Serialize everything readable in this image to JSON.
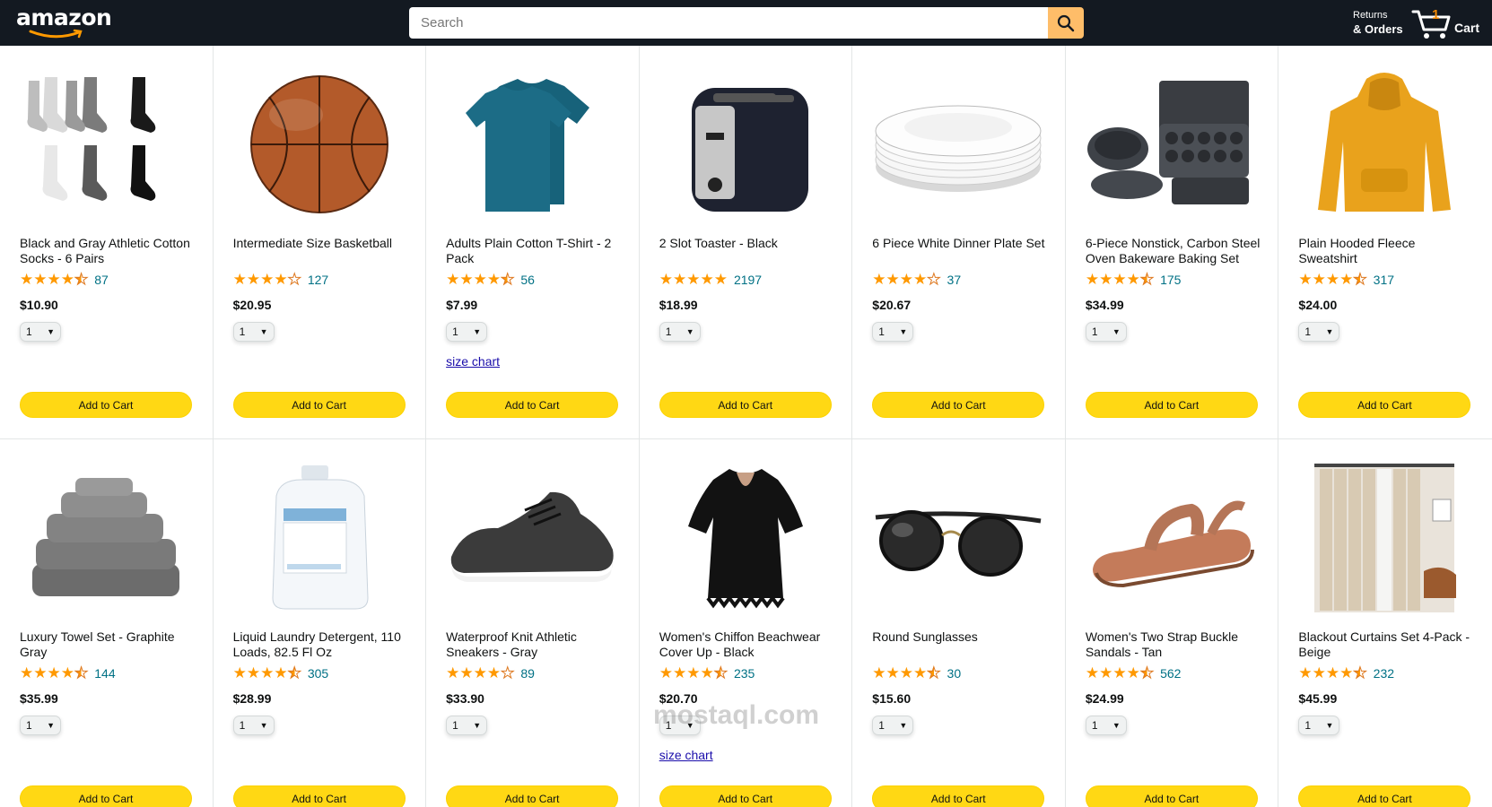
{
  "header": {
    "logo_text": "amazon",
    "search_placeholder": "Search",
    "returns_line1": "Returns",
    "returns_line2": "& Orders",
    "cart_count": "1",
    "cart_label": "Cart"
  },
  "products": [
    {
      "name": "Black and Gray Athletic Cotton Socks - 6 Pairs",
      "stars": 4.5,
      "count": "87",
      "price": "$10.90",
      "qty": "1",
      "button": "Add to Cart",
      "icon": "socks-image"
    },
    {
      "name": "Intermediate Size Basketball",
      "stars": 4,
      "count": "127",
      "price": "$20.95",
      "qty": "1",
      "button": "Add to Cart",
      "icon": "basketball-image"
    },
    {
      "name": "Adults Plain Cotton T-Shirt - 2 Pack",
      "stars": 4.5,
      "count": "56",
      "price": "$7.99",
      "qty": "1",
      "button": "Add to Cart",
      "size_chart": "size chart",
      "icon": "tshirt-image"
    },
    {
      "name": "2 Slot Toaster - Black",
      "stars": 5,
      "count": "2197",
      "price": "$18.99",
      "qty": "1",
      "button": "Add to Cart",
      "icon": "toaster-image"
    },
    {
      "name": "6 Piece White Dinner Plate Set",
      "stars": 4,
      "count": "37",
      "price": "$20.67",
      "qty": "1",
      "button": "Add to Cart",
      "icon": "plates-image"
    },
    {
      "name": "6-Piece Nonstick, Carbon Steel Oven Bakeware Baking Set",
      "stars": 4.5,
      "count": "175",
      "price": "$34.99",
      "qty": "1",
      "button": "Add to Cart",
      "icon": "bakeware-image"
    },
    {
      "name": "Plain Hooded Fleece Sweatshirt",
      "stars": 4.5,
      "count": "317",
      "price": "$24.00",
      "qty": "1",
      "button": "Add to Cart",
      "icon": "hoodie-image"
    },
    {
      "name": "Luxury Towel Set - Graphite Gray",
      "stars": 4.5,
      "count": "144",
      "price": "$35.99",
      "qty": "1",
      "button": "Add to Cart",
      "icon": "towels-image"
    },
    {
      "name": "Liquid Laundry Detergent, 110 Loads, 82.5 Fl Oz",
      "stars": 4.5,
      "count": "305",
      "price": "$28.99",
      "qty": "1",
      "button": "Add to Cart",
      "icon": "detergent-image"
    },
    {
      "name": "Waterproof Knit Athletic Sneakers - Gray",
      "stars": 4,
      "count": "89",
      "price": "$33.90",
      "qty": "1",
      "button": "Add to Cart",
      "icon": "sneaker-image"
    },
    {
      "name": "Women's Chiffon Beachwear Cover Up - Black",
      "stars": 4.5,
      "count": "235",
      "price": "$20.70",
      "qty": "1",
      "button": "Add to Cart",
      "size_chart": "size chart",
      "icon": "coverup-image"
    },
    {
      "name": "Round Sunglasses",
      "stars": 4.5,
      "count": "30",
      "price": "$15.60",
      "qty": "1",
      "button": "Add to Cart",
      "icon": "sunglasses-image"
    },
    {
      "name": "Women's Two Strap Buckle Sandals - Tan",
      "stars": 4.5,
      "count": "562",
      "price": "$24.99",
      "qty": "1",
      "button": "Add to Cart",
      "icon": "sandal-image"
    },
    {
      "name": "Blackout Curtains Set 4-Pack - Beige",
      "stars": 4.5,
      "count": "232",
      "price": "$45.99",
      "qty": "1",
      "button": "Add to Cart",
      "icon": "curtains-image"
    }
  ],
  "watermark": "mostaql.com",
  "colors": {
    "header_bg": "#131921",
    "search_button": "#febd69",
    "add_button": "#ffd814",
    "star": "#ff9900",
    "link": "#007185",
    "cart_count": "#f08804"
  }
}
